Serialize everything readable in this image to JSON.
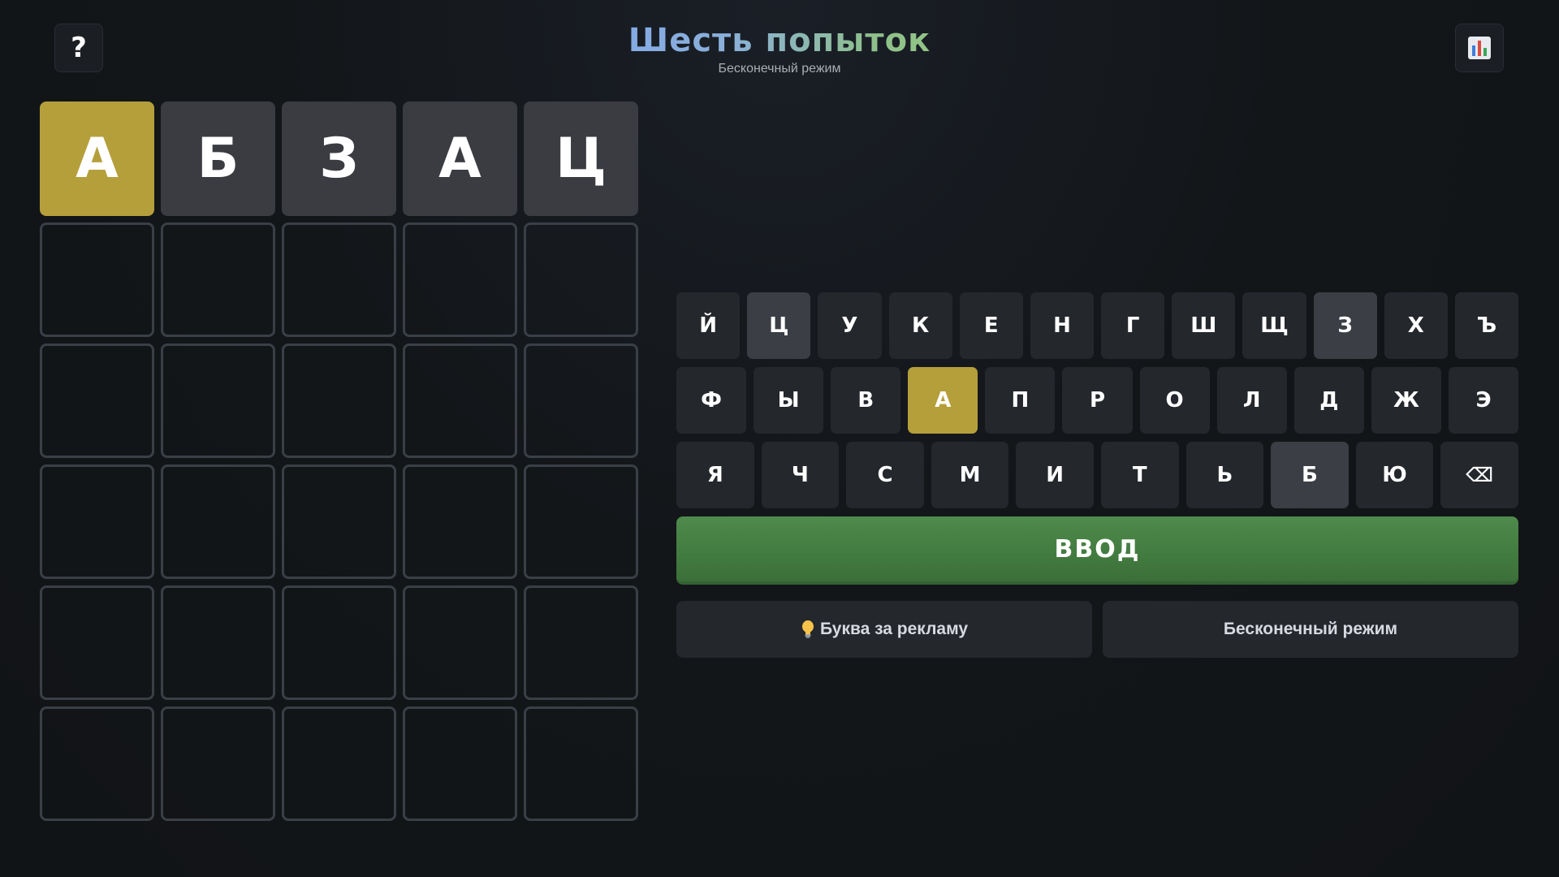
{
  "header": {
    "help_label": "?",
    "title": "Шесть попыток",
    "subtitle": "Бесконечный режим",
    "stats_icon": "bar-chart-icon"
  },
  "colors": {
    "present": "#b59f3b",
    "absent": "#3a3c42",
    "enter": "#4a8548"
  },
  "board": {
    "rows": [
      [
        {
          "letter": "А",
          "state": "present"
        },
        {
          "letter": "Б",
          "state": "absent"
        },
        {
          "letter": "З",
          "state": "absent"
        },
        {
          "letter": "А",
          "state": "absent"
        },
        {
          "letter": "Ц",
          "state": "absent"
        }
      ],
      [
        {
          "letter": "",
          "state": "empty"
        },
        {
          "letter": "",
          "state": "empty"
        },
        {
          "letter": "",
          "state": "empty"
        },
        {
          "letter": "",
          "state": "empty"
        },
        {
          "letter": "",
          "state": "empty"
        }
      ],
      [
        {
          "letter": "",
          "state": "empty"
        },
        {
          "letter": "",
          "state": "empty"
        },
        {
          "letter": "",
          "state": "empty"
        },
        {
          "letter": "",
          "state": "empty"
        },
        {
          "letter": "",
          "state": "empty"
        }
      ],
      [
        {
          "letter": "",
          "state": "empty"
        },
        {
          "letter": "",
          "state": "empty"
        },
        {
          "letter": "",
          "state": "empty"
        },
        {
          "letter": "",
          "state": "empty"
        },
        {
          "letter": "",
          "state": "empty"
        }
      ],
      [
        {
          "letter": "",
          "state": "empty"
        },
        {
          "letter": "",
          "state": "empty"
        },
        {
          "letter": "",
          "state": "empty"
        },
        {
          "letter": "",
          "state": "empty"
        },
        {
          "letter": "",
          "state": "empty"
        }
      ],
      [
        {
          "letter": "",
          "state": "empty"
        },
        {
          "letter": "",
          "state": "empty"
        },
        {
          "letter": "",
          "state": "empty"
        },
        {
          "letter": "",
          "state": "empty"
        },
        {
          "letter": "",
          "state": "empty"
        }
      ]
    ]
  },
  "keyboard": {
    "rows": [
      [
        {
          "label": "Й",
          "state": "unused"
        },
        {
          "label": "Ц",
          "state": "absent"
        },
        {
          "label": "У",
          "state": "unused"
        },
        {
          "label": "К",
          "state": "unused"
        },
        {
          "label": "Е",
          "state": "unused"
        },
        {
          "label": "Н",
          "state": "unused"
        },
        {
          "label": "Г",
          "state": "unused"
        },
        {
          "label": "Ш",
          "state": "unused"
        },
        {
          "label": "Щ",
          "state": "unused"
        },
        {
          "label": "З",
          "state": "absent"
        },
        {
          "label": "Х",
          "state": "unused"
        },
        {
          "label": "Ъ",
          "state": "unused"
        }
      ],
      [
        {
          "label": "Ф",
          "state": "unused"
        },
        {
          "label": "Ы",
          "state": "unused"
        },
        {
          "label": "В",
          "state": "unused"
        },
        {
          "label": "А",
          "state": "present"
        },
        {
          "label": "П",
          "state": "unused"
        },
        {
          "label": "Р",
          "state": "unused"
        },
        {
          "label": "О",
          "state": "unused"
        },
        {
          "label": "Л",
          "state": "unused"
        },
        {
          "label": "Д",
          "state": "unused"
        },
        {
          "label": "Ж",
          "state": "unused"
        },
        {
          "label": "Э",
          "state": "unused"
        }
      ],
      [
        {
          "label": "Я",
          "state": "unused"
        },
        {
          "label": "Ч",
          "state": "unused"
        },
        {
          "label": "С",
          "state": "unused"
        },
        {
          "label": "М",
          "state": "unused"
        },
        {
          "label": "И",
          "state": "unused"
        },
        {
          "label": "Т",
          "state": "unused"
        },
        {
          "label": "Ь",
          "state": "unused"
        },
        {
          "label": "Б",
          "state": "absent"
        },
        {
          "label": "Ю",
          "state": "unused"
        },
        {
          "label": "⌫",
          "state": "backspace"
        }
      ]
    ],
    "enter_label": "ВВОД"
  },
  "actions": {
    "hint_icon": "lightbulb-icon",
    "hint_label": "Буква за рекламу",
    "mode_label": "Бесконечный режим"
  }
}
